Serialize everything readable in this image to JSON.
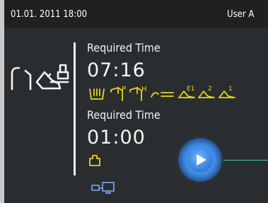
{
  "header": {
    "datetime": "01.01. 2011 18:00",
    "user": "User A"
  },
  "program1": {
    "label": "Required Time",
    "time": "07:16"
  },
  "program2": {
    "label": "Required Time",
    "time": "01:00"
  },
  "colors": {
    "accent_yellow": "#e8d21a",
    "accent_blue": "#3b82e0",
    "connector_green": "#3ec9a0"
  },
  "icons": [
    "handpiece-care-icon",
    "cup-icon",
    "turbine-p-icon",
    "turbine-h-icon",
    "hose-icon",
    "contra-angle-e1-icon",
    "contra-angle-2-icon",
    "contra-angle-1-icon",
    "module-icon",
    "play-icon",
    "pc-connection-icon"
  ]
}
